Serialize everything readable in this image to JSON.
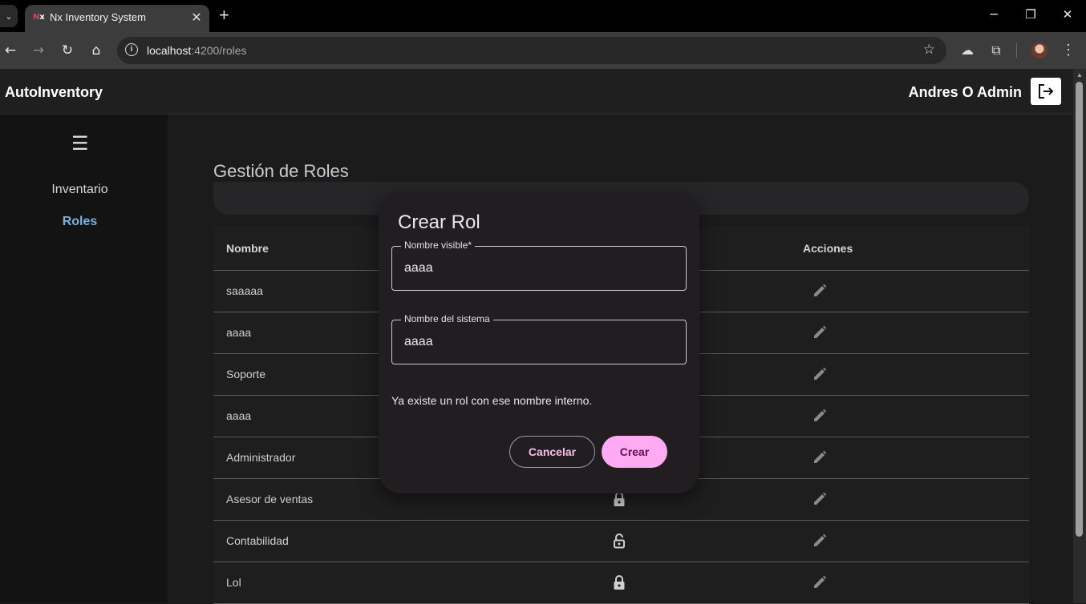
{
  "browser": {
    "tab_title": "Nx Inventory System",
    "favicon_text": "Nx",
    "new_tab_symbol": "+",
    "url_host": "localhost",
    "url_path": ":4200/roles"
  },
  "app": {
    "brand": "AutoInventory",
    "user_name": "Andres O Admin"
  },
  "sidebar": {
    "items": [
      {
        "label": "Inventario",
        "active": false
      },
      {
        "label": "Roles",
        "active": true
      }
    ]
  },
  "main": {
    "title": "Gestión de Roles",
    "table": {
      "headers": [
        "Nombre",
        "Acciones"
      ],
      "rows": [
        {
          "name": "saaaaa",
          "lock": null
        },
        {
          "name": "aaaa",
          "lock": null
        },
        {
          "name": "Soporte",
          "lock": null
        },
        {
          "name": "aaaa",
          "lock": null
        },
        {
          "name": "Administrador",
          "lock": null
        },
        {
          "name": "Asesor de ventas",
          "lock": "locked"
        },
        {
          "name": "Contabilidad",
          "lock": "unlocked"
        },
        {
          "name": "Lol",
          "lock": "locked"
        }
      ]
    }
  },
  "dialog": {
    "title": "Crear Rol",
    "fields": [
      {
        "label": "Nombre visible*",
        "value": "aaaa"
      },
      {
        "label": "Nombre del sistema",
        "value": "aaaa"
      }
    ],
    "error": "Ya existe un rol con ese nombre interno.",
    "cancel_label": "Cancelar",
    "create_label": "Crear"
  },
  "colors": {
    "accent": "#ffabf3",
    "sidebar_active": "#7ab1dd"
  }
}
